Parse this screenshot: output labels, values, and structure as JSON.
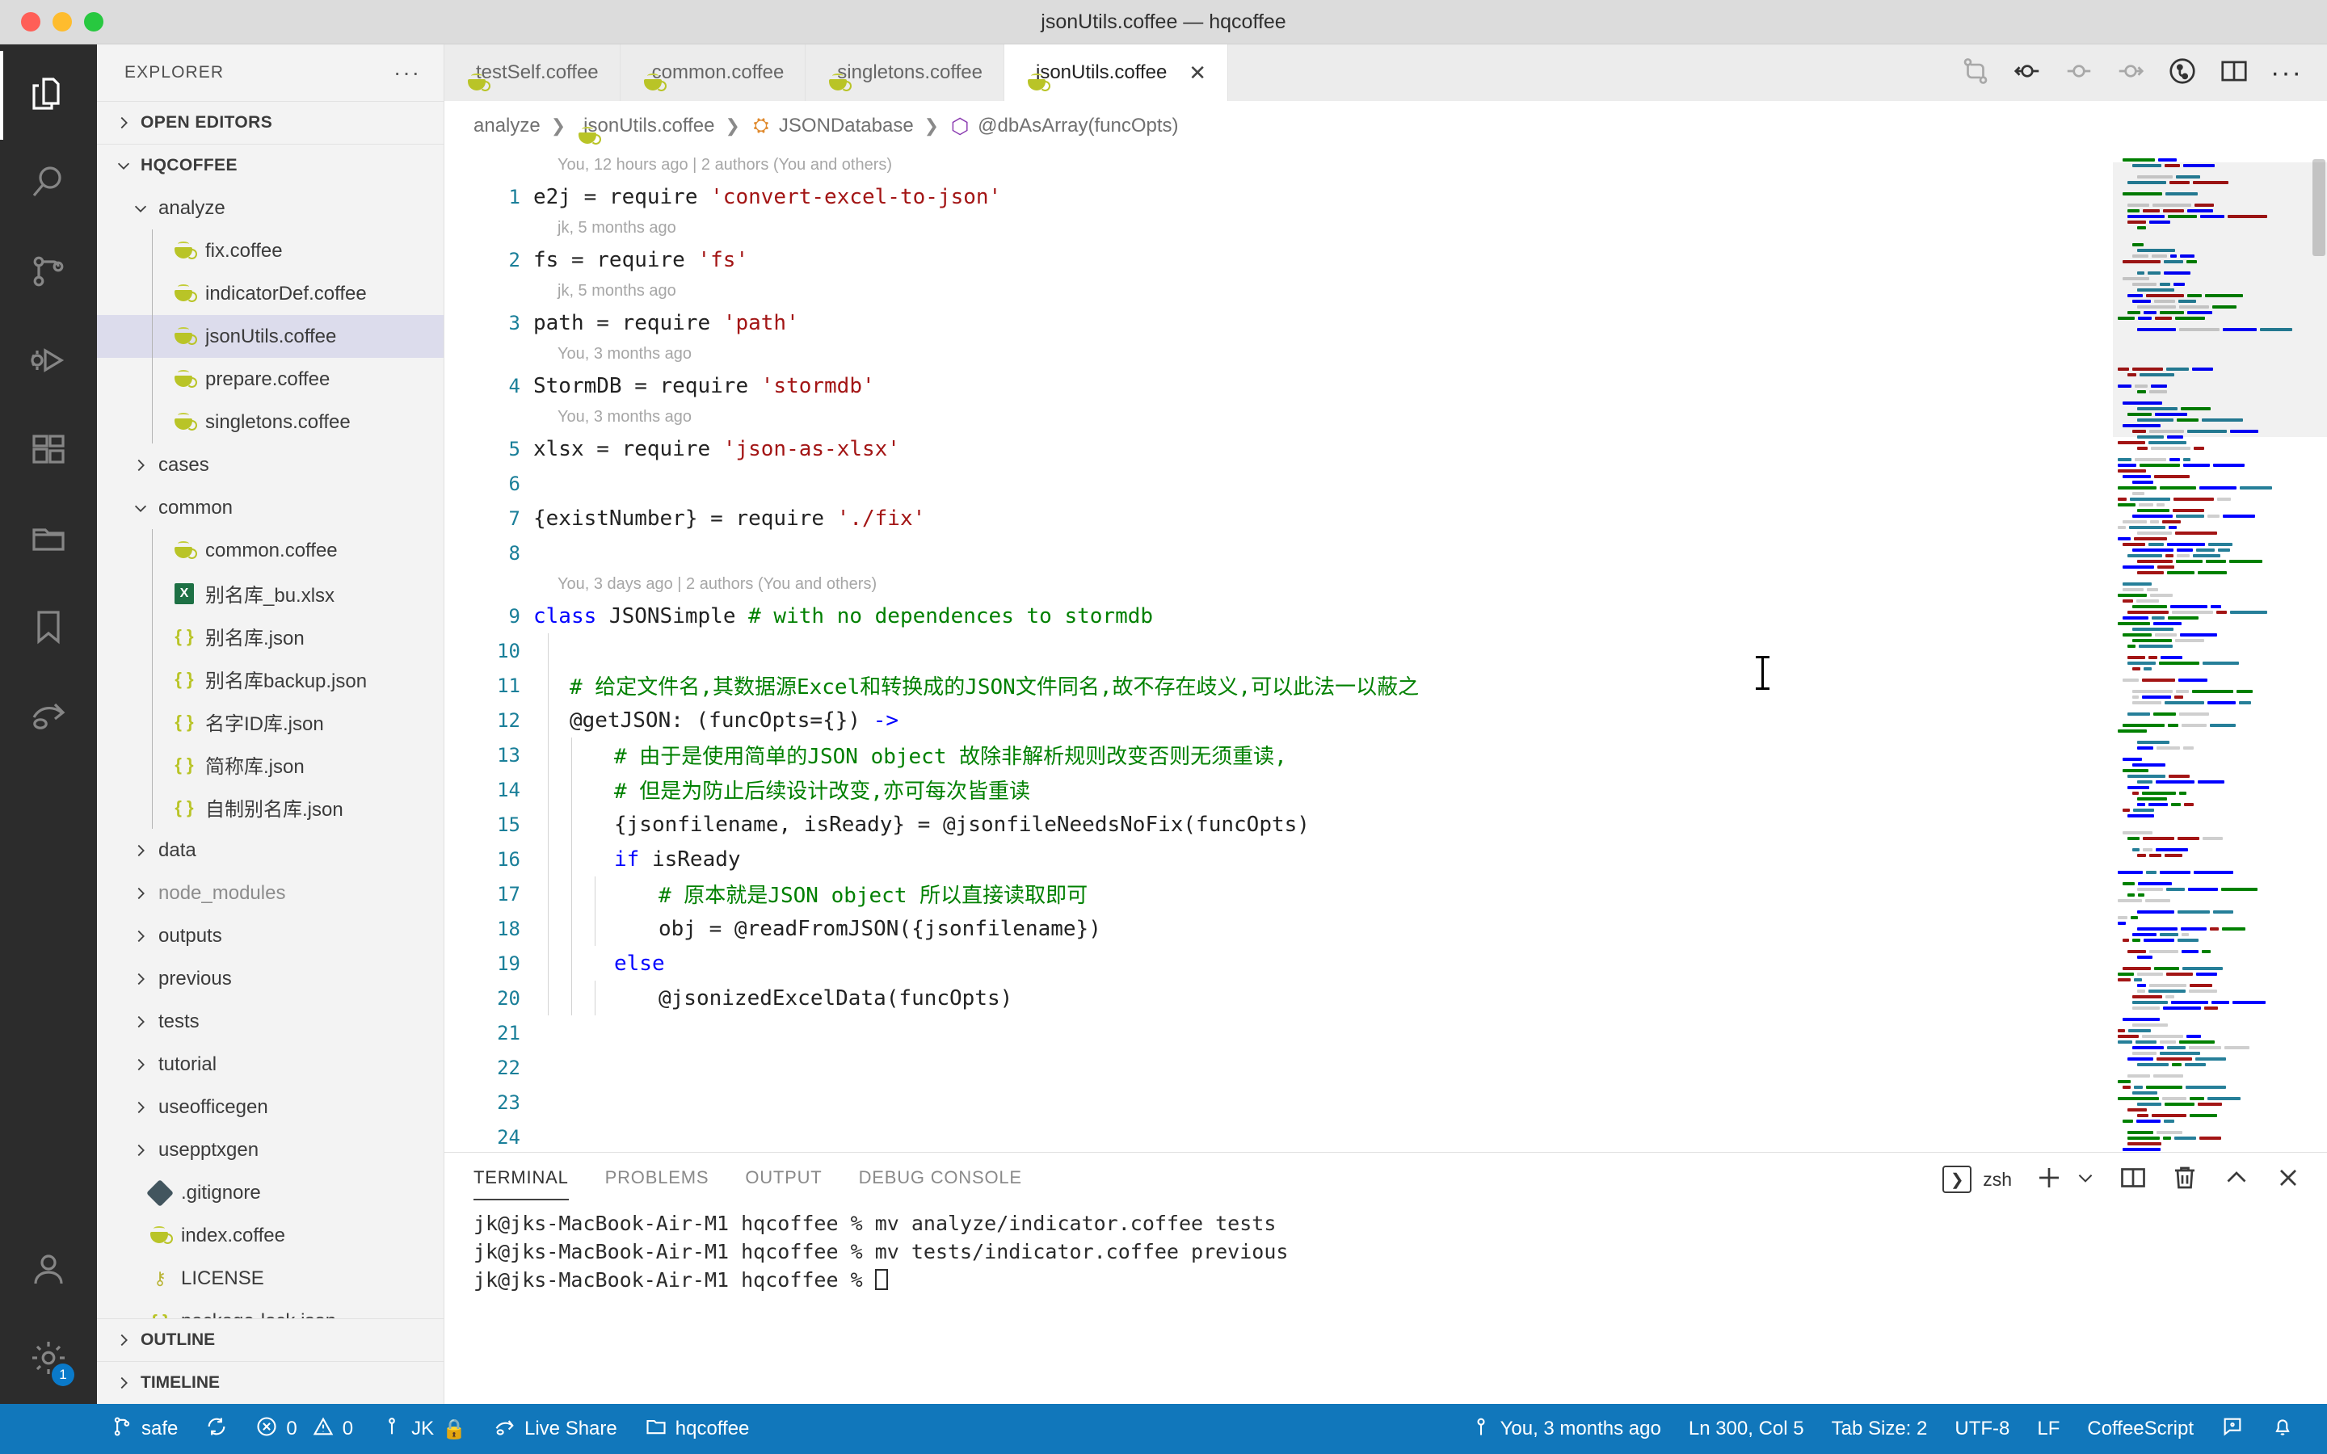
{
  "window": {
    "title": "jsonUtils.coffee — hqcoffee",
    "traffic_lights": [
      "close",
      "minimize",
      "zoom"
    ]
  },
  "activitybar": {
    "items": [
      {
        "name": "explorer",
        "icon": "files-icon",
        "active": true
      },
      {
        "name": "search",
        "icon": "search-icon",
        "active": false
      },
      {
        "name": "source-control",
        "icon": "source-control-icon",
        "active": false
      },
      {
        "name": "run-and-debug",
        "icon": "debug-icon",
        "active": false
      },
      {
        "name": "extensions",
        "icon": "extensions-icon",
        "active": false
      },
      {
        "name": "project-manager",
        "icon": "folder-icon",
        "active": false
      },
      {
        "name": "bookmarks",
        "icon": "bookmark-icon",
        "active": false
      },
      {
        "name": "live-share",
        "icon": "live-share-icon",
        "active": false
      }
    ],
    "bottom": [
      {
        "name": "accounts",
        "icon": "account-icon",
        "badge": ""
      },
      {
        "name": "settings",
        "icon": "gear-icon",
        "badge": "1"
      }
    ]
  },
  "sidebar": {
    "header": "EXPLORER",
    "more_actions": "···",
    "sections": [
      {
        "label": "OPEN EDITORS",
        "expanded": false
      },
      {
        "label": "HQCOFFEE",
        "expanded": true
      }
    ],
    "tree": [
      {
        "label": "analyze",
        "type": "folder",
        "depth": 1,
        "expanded": true
      },
      {
        "label": "fix.coffee",
        "type": "coffee",
        "depth": 2
      },
      {
        "label": "indicatorDef.coffee",
        "type": "coffee",
        "depth": 2
      },
      {
        "label": "jsonUtils.coffee",
        "type": "coffee",
        "depth": 2,
        "selected": true
      },
      {
        "label": "prepare.coffee",
        "type": "coffee",
        "depth": 2
      },
      {
        "label": "singletons.coffee",
        "type": "coffee",
        "depth": 2
      },
      {
        "label": "cases",
        "type": "folder",
        "depth": 1,
        "expanded": false
      },
      {
        "label": "common",
        "type": "folder",
        "depth": 1,
        "expanded": true
      },
      {
        "label": "common.coffee",
        "type": "coffee",
        "depth": 2
      },
      {
        "label": "别名库_bu.xlsx",
        "type": "xlsx",
        "depth": 2
      },
      {
        "label": "别名库.json",
        "type": "json",
        "depth": 2
      },
      {
        "label": "别名库backup.json",
        "type": "json",
        "depth": 2
      },
      {
        "label": "名字ID库.json",
        "type": "json",
        "depth": 2
      },
      {
        "label": "简称库.json",
        "type": "json",
        "depth": 2
      },
      {
        "label": "自制别名库.json",
        "type": "json",
        "depth": 2
      },
      {
        "label": "data",
        "type": "folder",
        "depth": 1,
        "expanded": false
      },
      {
        "label": "node_modules",
        "type": "folder",
        "depth": 1,
        "expanded": false,
        "dim": true
      },
      {
        "label": "outputs",
        "type": "folder",
        "depth": 1,
        "expanded": false
      },
      {
        "label": "previous",
        "type": "folder",
        "depth": 1,
        "expanded": false
      },
      {
        "label": "tests",
        "type": "folder",
        "depth": 1,
        "expanded": false
      },
      {
        "label": "tutorial",
        "type": "folder",
        "depth": 1,
        "expanded": false
      },
      {
        "label": "useofficegen",
        "type": "folder",
        "depth": 1,
        "expanded": false
      },
      {
        "label": "usepptxgen",
        "type": "folder",
        "depth": 1,
        "expanded": false
      },
      {
        "label": ".gitignore",
        "type": "git",
        "depth": 1
      },
      {
        "label": "index.coffee",
        "type": "coffee",
        "depth": 1
      },
      {
        "label": "LICENSE",
        "type": "key",
        "depth": 1
      },
      {
        "label": "package-lock.json",
        "type": "json",
        "depth": 1
      }
    ],
    "footer_sections": [
      {
        "label": "OUTLINE",
        "expanded": false
      },
      {
        "label": "TIMELINE",
        "expanded": false
      }
    ]
  },
  "editor": {
    "tabs": [
      {
        "label": "testSelf.coffee",
        "icon": "coffee-icon",
        "active": false
      },
      {
        "label": "common.coffee",
        "icon": "coffee-icon",
        "active": false
      },
      {
        "label": "singletons.coffee",
        "icon": "coffee-icon",
        "active": false
      },
      {
        "label": "jsonUtils.coffee",
        "icon": "coffee-icon",
        "active": true,
        "close": "✕"
      }
    ],
    "tab_actions": [
      {
        "name": "compare-changes-icon",
        "muted": true
      },
      {
        "name": "previous-change-icon",
        "muted": false
      },
      {
        "name": "current-change-icon",
        "muted": true
      },
      {
        "name": "next-change-icon",
        "muted": true
      },
      {
        "name": "gitlens-blame-icon",
        "muted": false
      },
      {
        "name": "split-editor-icon",
        "muted": false
      },
      {
        "name": "more-actions-icon",
        "label": "···"
      }
    ],
    "breadcrumb": [
      {
        "label": "analyze",
        "icon": "none"
      },
      {
        "label": "jsonUtils.coffee",
        "icon": "coffee-icon"
      },
      {
        "label": "JSONDatabase",
        "icon": "class-symbol-icon"
      },
      {
        "label": "@dbAsArray(funcOpts)",
        "icon": "method-symbol-icon"
      }
    ],
    "separator": "❯",
    "lines": [
      {
        "blame": "You, 12 hours ago | 2 authors (You and others)",
        "num": "1",
        "indent": 0,
        "tokens": [
          {
            "t": "e2j = require ",
            "c": "plain"
          },
          {
            "t": "'convert-excel-to-json'",
            "c": "str"
          }
        ]
      },
      {
        "blame": "jk, 5 months ago",
        "num": "2",
        "indent": 0,
        "tokens": [
          {
            "t": "fs = require ",
            "c": "plain"
          },
          {
            "t": "'fs'",
            "c": "str"
          }
        ]
      },
      {
        "blame": "jk, 5 months ago",
        "num": "3",
        "indent": 0,
        "tokens": [
          {
            "t": "path = require ",
            "c": "plain"
          },
          {
            "t": "'path'",
            "c": "str"
          }
        ]
      },
      {
        "blame": "You, 3 months ago",
        "num": "4",
        "indent": 0,
        "tokens": [
          {
            "t": "StormDB = require ",
            "c": "plain"
          },
          {
            "t": "'stormdb'",
            "c": "str"
          }
        ]
      },
      {
        "blame": "You, 3 months ago",
        "num": "5",
        "indent": 0,
        "tokens": [
          {
            "t": "xlsx = require ",
            "c": "plain"
          },
          {
            "t": "'json-as-xlsx'",
            "c": "str"
          }
        ]
      },
      {
        "blame": "",
        "num": "6",
        "indent": 0,
        "tokens": []
      },
      {
        "blame": "",
        "num": "7",
        "indent": 0,
        "tokens": [
          {
            "t": "{existNumber} = require ",
            "c": "plain"
          },
          {
            "t": "'./fix'",
            "c": "str"
          }
        ]
      },
      {
        "blame": "",
        "num": "8",
        "indent": 0,
        "tokens": []
      },
      {
        "blame": "You, 3 days ago | 2 authors (You and others)",
        "num": "9",
        "indent": 0,
        "tokens": [
          {
            "t": "class",
            "c": "kw"
          },
          {
            "t": " JSONSimple  ",
            "c": "plain"
          },
          {
            "t": "# with no dependences to stormdb",
            "c": "cmt"
          }
        ]
      },
      {
        "blame": "",
        "num": "10",
        "indent": 1,
        "tokens": []
      },
      {
        "blame": "",
        "num": "11",
        "indent": 1,
        "tokens": [
          {
            "t": "# 给定文件名,其数据源Excel和转换成的JSON文件同名,故不存在歧义,可以此法一以蔽之",
            "c": "cmt"
          }
        ]
      },
      {
        "blame": "",
        "num": "12",
        "indent": 1,
        "tokens": [
          {
            "t": "@getJSON: (funcOpts={}) ",
            "c": "plain"
          },
          {
            "t": "->",
            "c": "op"
          }
        ]
      },
      {
        "blame": "",
        "num": "13",
        "indent": 2,
        "tokens": [
          {
            "t": "# 由于是使用简单的JSON object 故除非解析规则改变否则无须重读,",
            "c": "cmt"
          }
        ]
      },
      {
        "blame": "",
        "num": "14",
        "indent": 2,
        "tokens": [
          {
            "t": "# 但是为防止后续设计改变,亦可每次皆重读",
            "c": "cmt"
          }
        ]
      },
      {
        "blame": "",
        "num": "15",
        "indent": 2,
        "tokens": [
          {
            "t": "{jsonfilename, isReady} = @jsonfileNeedsNoFix(funcOpts)",
            "c": "plain"
          }
        ]
      },
      {
        "blame": "",
        "num": "16",
        "indent": 2,
        "tokens": [
          {
            "t": "if",
            "c": "kw"
          },
          {
            "t": " isReady",
            "c": "plain"
          }
        ]
      },
      {
        "blame": "",
        "num": "17",
        "indent": 3,
        "tokens": [
          {
            "t": "# 原本就是JSON object 所以直接读取即可",
            "c": "cmt"
          }
        ]
      },
      {
        "blame": "",
        "num": "18",
        "indent": 3,
        "tokens": [
          {
            "t": "obj = @readFromJSON({jsonfilename})",
            "c": "plain"
          }
        ]
      },
      {
        "blame": "",
        "num": "19",
        "indent": 2,
        "tokens": [
          {
            "t": "else",
            "c": "kw"
          }
        ]
      },
      {
        "blame": "",
        "num": "20",
        "indent": 3,
        "tokens": [
          {
            "t": "@jsonizedExcelData(funcOpts)",
            "c": "plain"
          }
        ]
      },
      {
        "blame": "",
        "num": "21",
        "indent": 0,
        "tokens": []
      },
      {
        "blame": "",
        "num": "22",
        "indent": 0,
        "tokens": []
      },
      {
        "blame": "",
        "num": "23",
        "indent": 0,
        "tokens": []
      },
      {
        "blame": "",
        "num": "24",
        "indent": 0,
        "tokens": []
      }
    ]
  },
  "panel": {
    "tabs": [
      {
        "label": "TERMINAL",
        "active": true
      },
      {
        "label": "PROBLEMS",
        "active": false
      },
      {
        "label": "OUTPUT",
        "active": false
      },
      {
        "label": "DEBUG CONSOLE",
        "active": false
      }
    ],
    "shell": "zsh",
    "actions": [
      {
        "name": "new-terminal-icon",
        "label": "+"
      },
      {
        "name": "terminal-dropdown-icon",
        "label": "⌄"
      },
      {
        "name": "split-terminal-icon",
        "label": "split"
      },
      {
        "name": "kill-terminal-icon",
        "label": "trash"
      },
      {
        "name": "maximize-panel-icon",
        "label": "^"
      },
      {
        "name": "close-panel-icon",
        "label": "✕"
      }
    ],
    "terminal_lines": [
      "jk@jks-MacBook-Air-M1 hqcoffee % mv analyze/indicator.coffee tests",
      "jk@jks-MacBook-Air-M1 hqcoffee % mv tests/indicator.coffee previous",
      "jk@jks-MacBook-Air-M1 hqcoffee % "
    ]
  },
  "statusbar": {
    "background": "#1177bb",
    "left": [
      {
        "name": "remote-safe",
        "icon": "source-control-icon",
        "label": "safe"
      },
      {
        "name": "sync",
        "icon": "sync-icon",
        "label": ""
      },
      {
        "name": "problems",
        "icon": "error-warning-icon",
        "label": "0  0",
        "errors": "0",
        "warnings": "0"
      },
      {
        "name": "gitlens-user",
        "icon": "person-icon",
        "label": "JK",
        "lock": "🔒"
      },
      {
        "name": "live-share",
        "icon": "live-share-icon",
        "label": "Live Share"
      },
      {
        "name": "workspace",
        "icon": "folder-icon",
        "label": "hqcoffee"
      }
    ],
    "right": [
      {
        "name": "git-blame",
        "icon": "blame-icon",
        "label": "You, 3 months ago"
      },
      {
        "name": "cursor-position",
        "label": "Ln 300, Col 5"
      },
      {
        "name": "tab-size",
        "label": "Tab Size: 2"
      },
      {
        "name": "encoding",
        "label": "UTF-8"
      },
      {
        "name": "eol",
        "label": "LF"
      },
      {
        "name": "language-mode",
        "label": "CoffeeScript"
      },
      {
        "name": "feedback",
        "icon": "feedback-icon",
        "label": ""
      },
      {
        "name": "notifications",
        "icon": "bell-icon",
        "label": ""
      }
    ]
  },
  "colors": {
    "accent": "#1177bb",
    "keyword": "#0000ff",
    "string": "#a31515",
    "comment": "#008000",
    "linenumber": "#1a7f99",
    "coffee": "#b9c427"
  }
}
